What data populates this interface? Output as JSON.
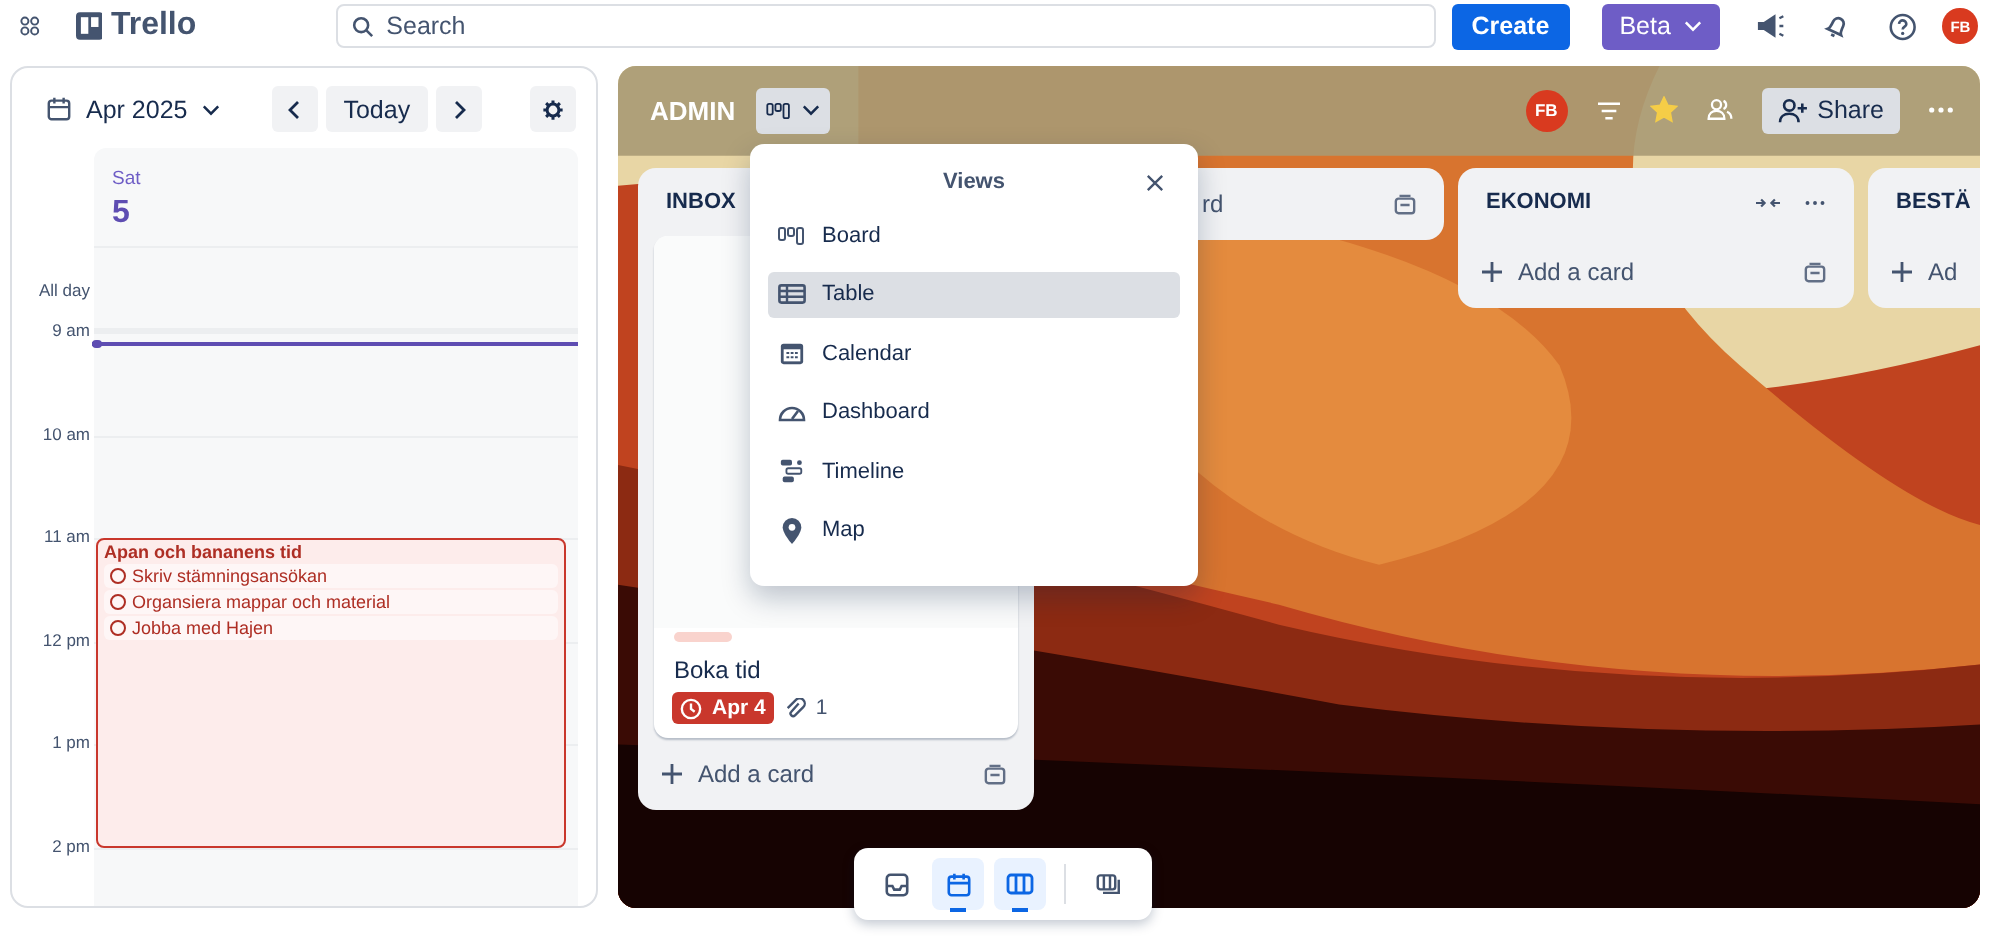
{
  "topbar": {
    "logo": "Trello",
    "search": {
      "placeholder": "Search"
    },
    "create": "Create",
    "beta": "Beta",
    "avatar": "FB"
  },
  "calendar": {
    "month": "Apr 2025",
    "today": "Today",
    "weekday": "Sat",
    "date": "5",
    "all_day": "All day",
    "hours": [
      "9 am",
      "10 am",
      "11 am",
      "12 pm",
      "1 pm",
      "2 pm"
    ],
    "events": [
      {
        "title": "Apan och bananens tid",
        "tasks": [
          {
            "text": "Skriv stämningsansökan",
            "checked": false
          },
          {
            "text": "Organsiera mappar och material",
            "checked": false
          },
          {
            "text": "Jobba med Hajen",
            "checked": false
          }
        ]
      }
    ]
  },
  "board": {
    "title": "ADMIN",
    "member": "FB",
    "starred": true,
    "share": "Share",
    "lists": [
      {
        "kind": "full",
        "title": "INBOX",
        "cards": [
          {
            "labels": [
              {
                "color": "#f9d3cd"
              }
            ],
            "title": "Boka tid",
            "due": "Apr 4",
            "overdue": true,
            "attachments": "1"
          }
        ],
        "add": "Add a card"
      },
      {
        "kind": "covered",
        "add": "rd"
      },
      {
        "kind": "full",
        "title": "EKONOMI",
        "add": "Add a card"
      },
      {
        "kind": "cut",
        "title": "BESTÄ",
        "add": "Ad"
      }
    ]
  },
  "views_menu": {
    "title": "Views",
    "items": [
      {
        "kind": "board",
        "label": "Board",
        "selected": false
      },
      {
        "kind": "table",
        "label": "Table",
        "selected": true
      },
      {
        "kind": "calendar",
        "label": "Calendar",
        "selected": false
      },
      {
        "kind": "dashboard",
        "label": "Dashboard",
        "selected": false
      },
      {
        "kind": "timeline",
        "label": "Timeline",
        "selected": false
      },
      {
        "kind": "map",
        "label": "Map",
        "selected": false
      }
    ]
  },
  "switcher": [
    {
      "kind": "inbox",
      "selected": false
    },
    {
      "kind": "planner",
      "selected": true
    },
    {
      "kind": "board",
      "selected": true
    },
    {
      "kind": "switch",
      "selected": false
    }
  ]
}
